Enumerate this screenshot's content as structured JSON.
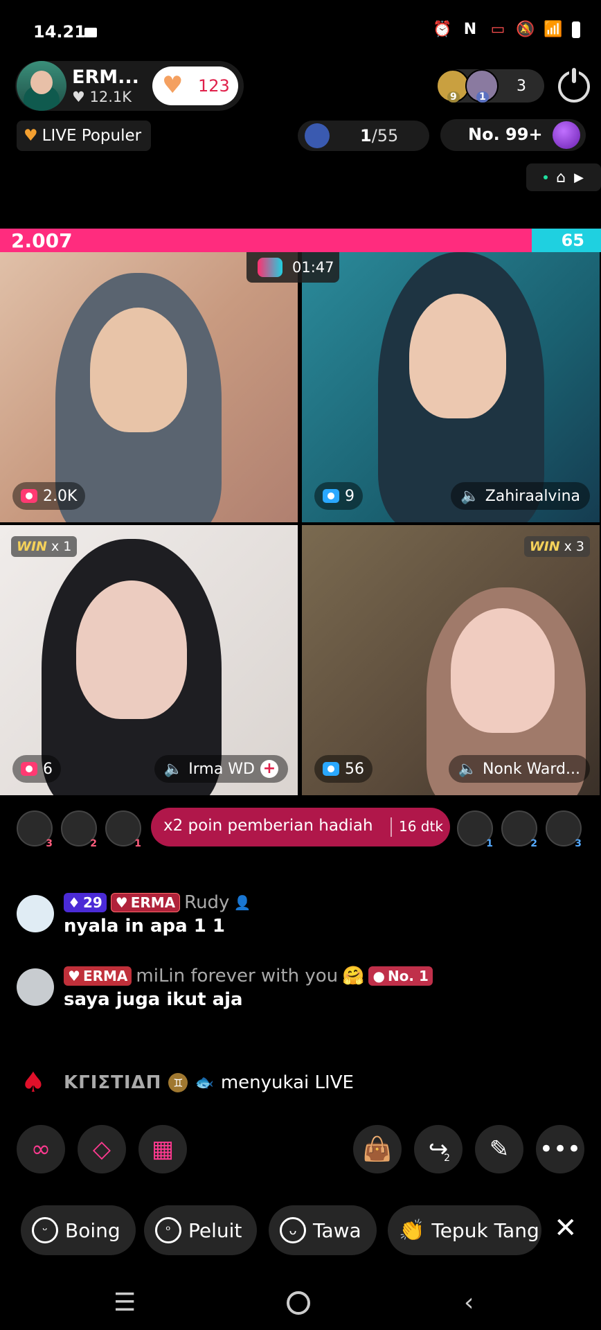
{
  "status_bar": {
    "time": "14.21"
  },
  "host": {
    "name": "ERM...",
    "likes": "12.1K",
    "like_count": "123"
  },
  "viewers": {
    "count": "3",
    "badge1": "9",
    "badge2": "1"
  },
  "popular": {
    "label": "LIVE Populer"
  },
  "rank": {
    "current": "1",
    "total": "/55"
  },
  "leaderboard": {
    "label": "No. 99+"
  },
  "score": {
    "left": "2.007",
    "right": "65"
  },
  "timer": "01:47",
  "tiles": [
    {
      "count": "2.0K",
      "name": ""
    },
    {
      "count": "9",
      "name": "Zahiraalvina"
    },
    {
      "count": "6",
      "name": "Irma WD",
      "win": "x 1"
    },
    {
      "count": "56",
      "name": "Nonk Ward...",
      "win": "x 3"
    }
  ],
  "win_label": "WIN",
  "rank_left": [
    "3",
    "2",
    "1"
  ],
  "rank_right": [
    "1",
    "2",
    "3"
  ],
  "bonus": {
    "text": "x2 poin pemberian hadiah",
    "time": "16 dtk"
  },
  "chat": [
    {
      "level": "29",
      "fanbadge": "ERMA",
      "user": "Rudy",
      "message": "nyala in apa 1 1"
    },
    {
      "fanbadge": "ERMA",
      "user": "miLin forever with you",
      "rank_badge": "No. 1",
      "message": "saya juga ikut aja"
    }
  ],
  "join": {
    "name": "KΓIΣTIΔП",
    "text": "menyukai LIVE"
  },
  "share_count": "2",
  "reactions": [
    {
      "label": "Boing",
      "icon": "tongue-face-icon"
    },
    {
      "label": "Peluit",
      "icon": "whistle-face-icon"
    },
    {
      "label": "Tawa",
      "icon": "laugh-face-icon"
    },
    {
      "label": "Tepuk Tang",
      "icon": "clap-icon"
    }
  ],
  "colors": {
    "accent": "#ff2c7e",
    "blue_team": "#1fd0e0",
    "bonus": "#b0174a"
  }
}
